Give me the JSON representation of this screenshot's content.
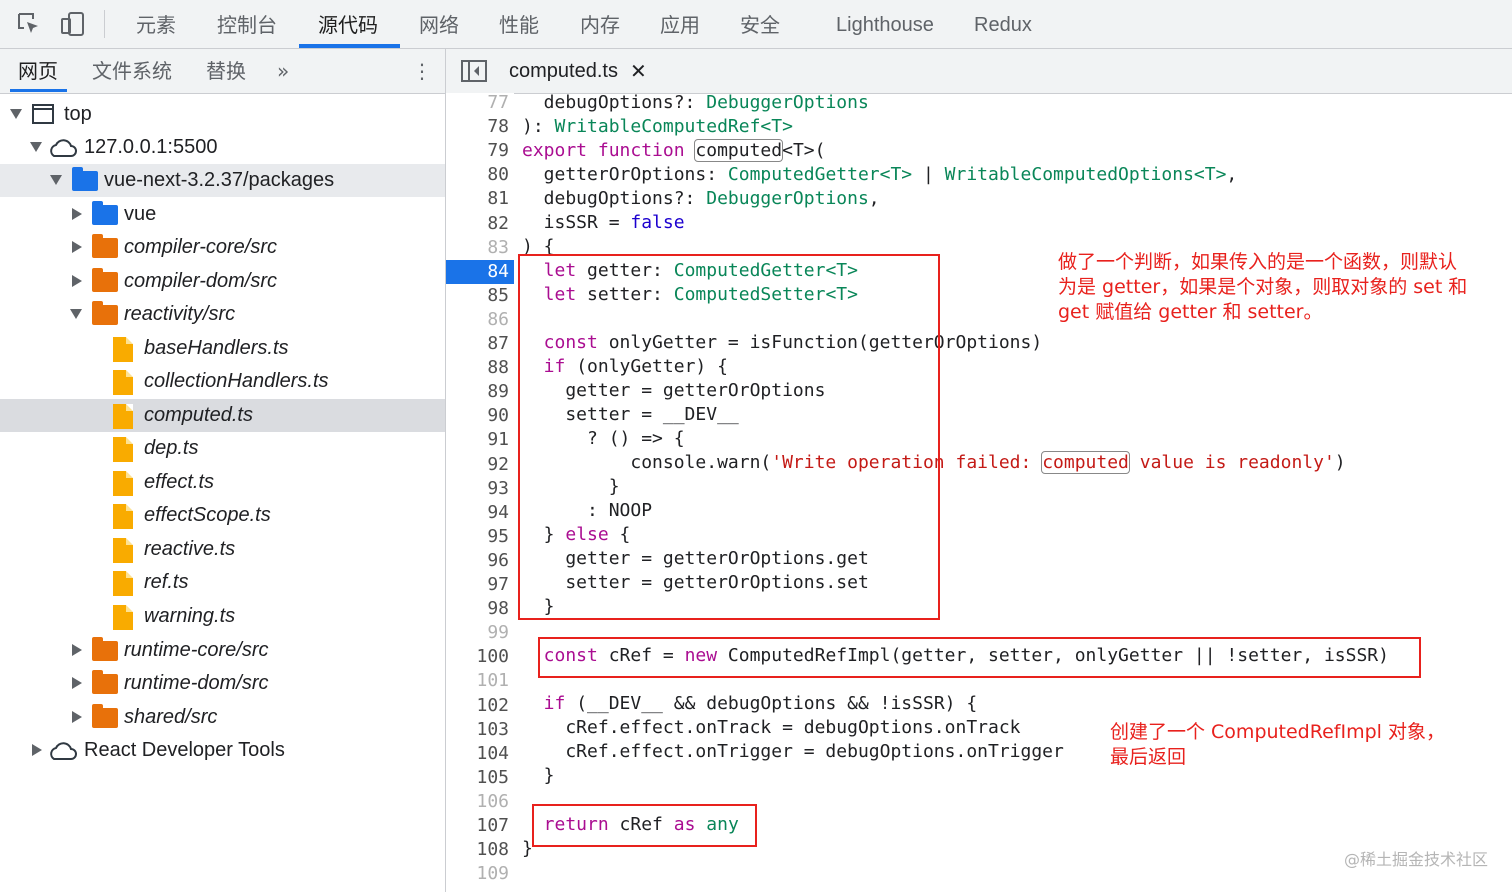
{
  "toolbar": {
    "tabs": [
      "元素",
      "控制台",
      "源代码",
      "网络",
      "性能",
      "内存",
      "应用",
      "安全",
      "Lighthouse",
      "Redux"
    ],
    "active": "源代码",
    "icons": [
      "inspect-element-icon",
      "device-toolbar-icon"
    ]
  },
  "navigator": {
    "tabs": [
      "网页",
      "文件系统",
      "替换"
    ],
    "more": "»",
    "menu": "⋮",
    "tree": [
      {
        "label": "top"
      },
      {
        "label": "127.0.0.1:5500"
      },
      {
        "label": "vue-next-3.2.37/packages"
      },
      {
        "label": "vue"
      },
      {
        "label": "compiler-core/src"
      },
      {
        "label": "compiler-dom/src"
      },
      {
        "label": "reactivity/src"
      },
      {
        "label": "baseHandlers.ts"
      },
      {
        "label": "collectionHandlers.ts"
      },
      {
        "label": "computed.ts"
      },
      {
        "label": "dep.ts"
      },
      {
        "label": "effect.ts"
      },
      {
        "label": "effectScope.ts"
      },
      {
        "label": "reactive.ts"
      },
      {
        "label": "ref.ts"
      },
      {
        "label": "warning.ts"
      },
      {
        "label": "runtime-core/src"
      },
      {
        "label": "runtime-dom/src"
      },
      {
        "label": "shared/src"
      },
      {
        "label": "React Developer Tools"
      }
    ]
  },
  "editor": {
    "tab_label": "computed.ts",
    "tab_close": "✕",
    "line_numbers": [
      "77",
      "78",
      "79",
      "80",
      "81",
      "82",
      "83",
      "84",
      "85",
      "86",
      "87",
      "88",
      "89",
      "90",
      "91",
      "92",
      "93",
      "94",
      "95",
      "96",
      "97",
      "98",
      "99",
      "100",
      "101",
      "102",
      "103",
      "104",
      "105",
      "106",
      "107",
      "108",
      "109"
    ],
    "breakpoint_line": "84",
    "code": {
      "l77a": "  debugOptions?: ",
      "l77b": "DebuggerOptions",
      "l78a": "): ",
      "l78b": "WritableComputedRef<T>",
      "l79a": "export function",
      "l79b": " ",
      "l79c": "computed",
      "l79d": "<T>(",
      "l80a": "  getterOrOptions: ",
      "l80b": "ComputedGetter<T>",
      "l80c": " | ",
      "l80d": "WritableComputedOptions<T>",
      "l80e": ",",
      "l81a": "  debugOptions?: ",
      "l81b": "DebuggerOptions",
      "l81c": ",",
      "l82a": "  isSSR = ",
      "l82b": "false",
      "l83": ") {",
      "l84a": "  let",
      "l84b": " getter: ",
      "l84c": "ComputedGetter<T>",
      "l85a": "  let",
      "l85b": " setter: ",
      "l85c": "ComputedSetter<T>",
      "l87a": "  const",
      "l87b": " onlyGetter = isFunction(getterOrOptions)",
      "l88a": "  if",
      "l88b": " (onlyGetter) {",
      "l89": "    getter = getterOrOptions",
      "l90": "    setter = __DEV__",
      "l91": "      ? () => {",
      "l92a": "          console.warn(",
      "l92b": "'Write operation failed: ",
      "l92c": "computed",
      "l92d": " value is readonly'",
      "l92e": ")",
      "l93": "        }",
      "l94": "      : NOOP",
      "l95a": "  } ",
      "l95b": "else",
      "l95c": " {",
      "l96": "    getter = getterOrOptions.get",
      "l97": "    setter = getterOrOptions.set",
      "l98": "  }",
      "l100a": "  const",
      "l100b": " cRef = ",
      "l100c": "new",
      "l100d": " ComputedRefImpl(getter, setter, onlyGetter || !setter, isSSR)",
      "l102a": "  if",
      "l102b": " (__DEV__ && debugOptions && !isSSR) {",
      "l103": "    cRef.effect.onTrack = debugOptions.onTrack",
      "l104": "    cRef.effect.onTrigger = debugOptions.onTrigger",
      "l105": "  }",
      "l107a": "  return",
      "l107b": " cRef ",
      "l107c": "as",
      "l107d": " ",
      "l107e": "any",
      "l108": "}"
    }
  },
  "annotations": {
    "note1_line1": "做了一个判断，如果传入的是一个函数，则默认",
    "note1_line2": "为是 getter，如果是个对象，则取对象的 set 和",
    "note1_line3": "get 赋值给 getter 和 setter。",
    "note2_line1": "创建了一个 ComputedRefImpl 对象，",
    "note2_line2": "最后返回",
    "color": "#e8211d"
  },
  "watermark": "@稀土掘金技术社区"
}
